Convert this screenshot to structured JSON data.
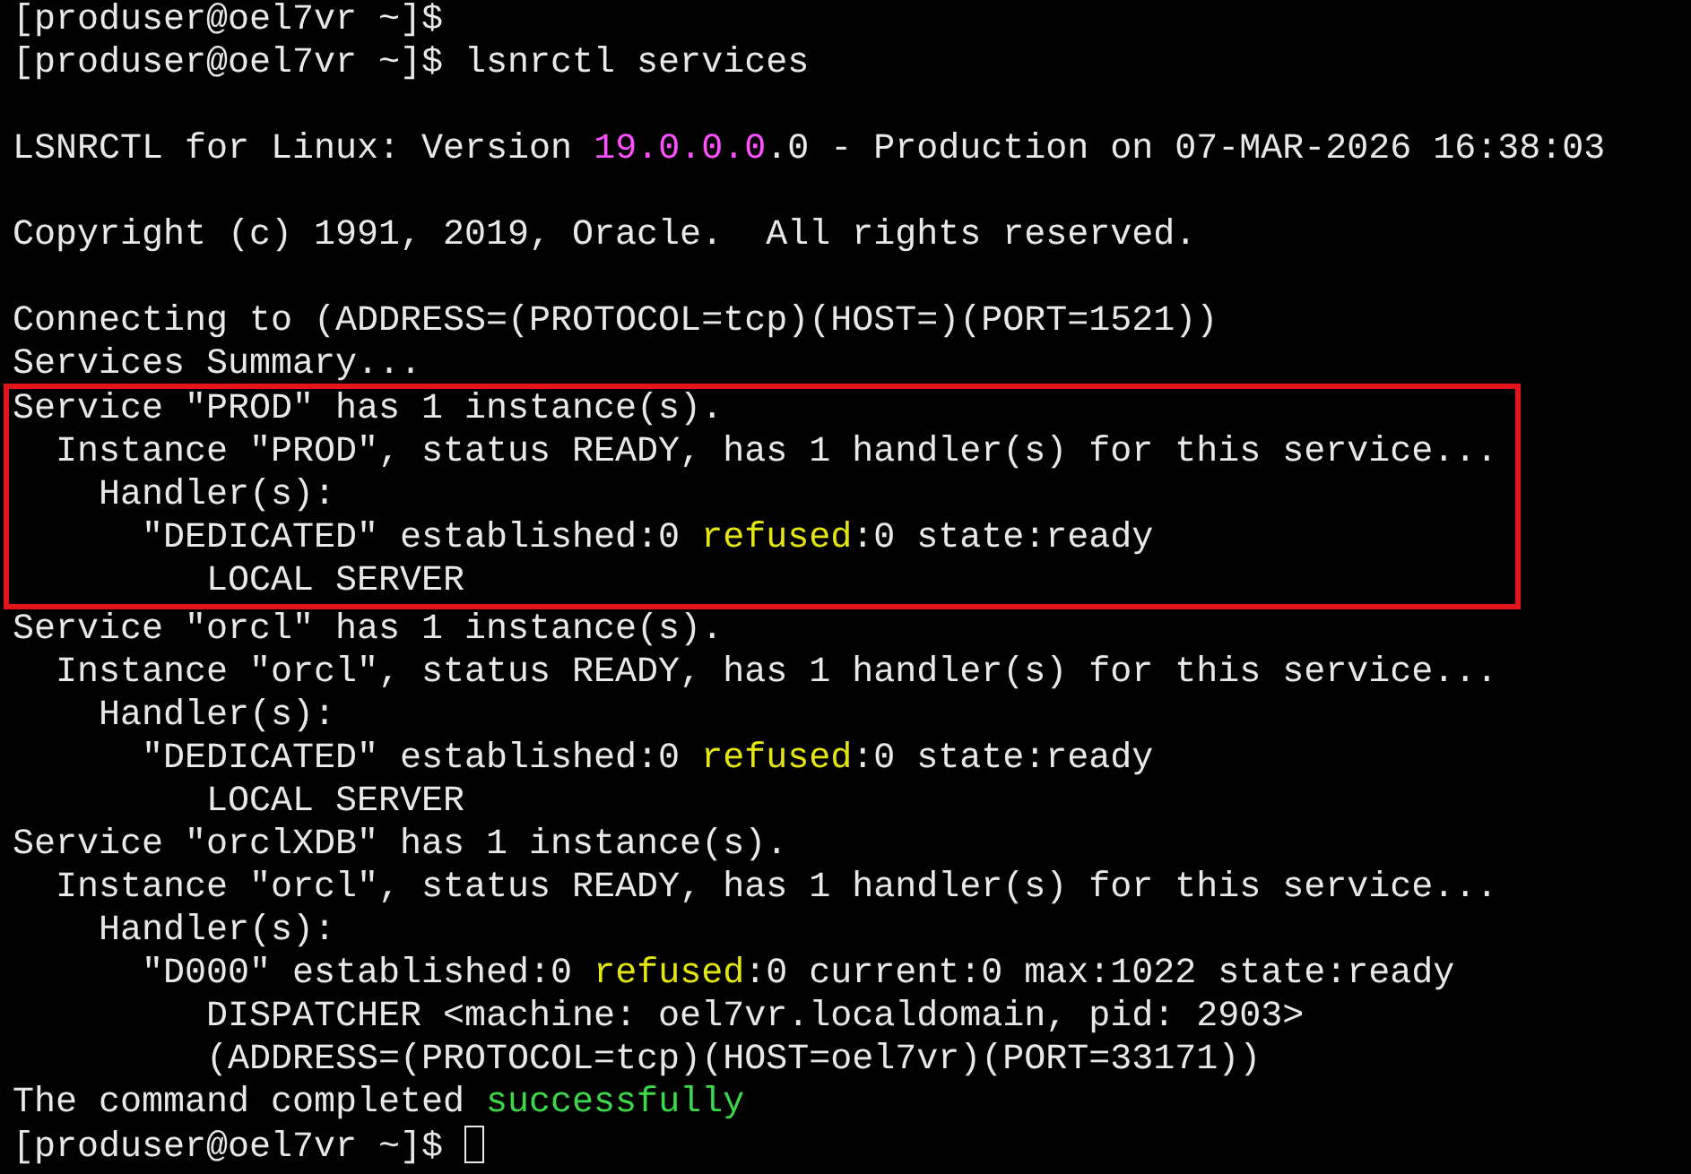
{
  "terminal": {
    "lines_before": [
      {
        "kind": "text",
        "segments": [
          {
            "text": "[produser@oel7vr ~]$"
          }
        ]
      },
      {
        "kind": "text",
        "segments": [
          {
            "text": "[produser@oel7vr ~]$ lsnrctl services"
          }
        ]
      },
      {
        "kind": "blank"
      },
      {
        "kind": "text",
        "segments": [
          {
            "text": "LSNRCTL for Linux: Version "
          },
          {
            "text": "19.0.0.0",
            "color": "#ff4fff"
          },
          {
            "text": ".0 - Production on 07-MAR-2026 16:38:03"
          }
        ]
      },
      {
        "kind": "blank"
      },
      {
        "kind": "text",
        "segments": [
          {
            "text": "Copyright (c) 1991, 2019, Oracle.  All rights reserved."
          }
        ]
      },
      {
        "kind": "blank"
      },
      {
        "kind": "text",
        "segments": [
          {
            "text": "Connecting to (ADDRESS=(PROTOCOL=tcp)(HOST=)(PORT=1521))"
          }
        ]
      },
      {
        "kind": "text",
        "segments": [
          {
            "text": "Services Summary..."
          }
        ]
      }
    ],
    "highlighted_lines": [
      {
        "kind": "text",
        "segments": [
          {
            "text": "Service \"PROD\" has 1 instance(s)."
          }
        ]
      },
      {
        "kind": "text",
        "segments": [
          {
            "text": "  Instance \"PROD\", status READY, has 1 handler(s) for this service..."
          }
        ]
      },
      {
        "kind": "text",
        "segments": [
          {
            "text": "    Handler(s):"
          }
        ]
      },
      {
        "kind": "text",
        "segments": [
          {
            "text": "      \"DEDICATED\" established:0 "
          },
          {
            "text": "refused",
            "color": "#e5e510"
          },
          {
            "text": ":0 state:ready"
          }
        ]
      },
      {
        "kind": "text",
        "segments": [
          {
            "text": "         LOCAL SERVER"
          }
        ]
      }
    ],
    "lines_after": [
      {
        "kind": "text",
        "segments": [
          {
            "text": "Service \"orcl\" has 1 instance(s)."
          }
        ]
      },
      {
        "kind": "text",
        "segments": [
          {
            "text": "  Instance \"orcl\", status READY, has 1 handler(s) for this service..."
          }
        ]
      },
      {
        "kind": "text",
        "segments": [
          {
            "text": "    Handler(s):"
          }
        ]
      },
      {
        "kind": "text",
        "segments": [
          {
            "text": "      \"DEDICATED\" established:0 "
          },
          {
            "text": "refused",
            "color": "#e5e510"
          },
          {
            "text": ":0 state:ready"
          }
        ]
      },
      {
        "kind": "text",
        "segments": [
          {
            "text": "         LOCAL SERVER"
          }
        ]
      },
      {
        "kind": "text",
        "segments": [
          {
            "text": "Service \"orclXDB\" has 1 instance(s)."
          }
        ]
      },
      {
        "kind": "text",
        "segments": [
          {
            "text": "  Instance \"orcl\", status READY, has 1 handler(s) for this service..."
          }
        ]
      },
      {
        "kind": "text",
        "segments": [
          {
            "text": "    Handler(s):"
          }
        ]
      },
      {
        "kind": "text",
        "segments": [
          {
            "text": "      \"D000\" established:0 "
          },
          {
            "text": "refused",
            "color": "#e5e510"
          },
          {
            "text": ":0 current:0 max:1022 state:ready"
          }
        ]
      },
      {
        "kind": "text",
        "segments": [
          {
            "text": "         DISPATCHER <machine: oel7vr.localdomain, pid: 2903>"
          }
        ]
      },
      {
        "kind": "text",
        "segments": [
          {
            "text": "         (ADDRESS=(PROTOCOL=tcp)(HOST=oel7vr)(PORT=33171))"
          }
        ]
      },
      {
        "kind": "text",
        "segments": [
          {
            "text": "The command completed "
          },
          {
            "text": "successfully",
            "color": "#3ad94a"
          }
        ]
      },
      {
        "kind": "prompt",
        "segments": [
          {
            "text": "[produser@oel7vr ~]$ "
          }
        ]
      }
    ]
  }
}
